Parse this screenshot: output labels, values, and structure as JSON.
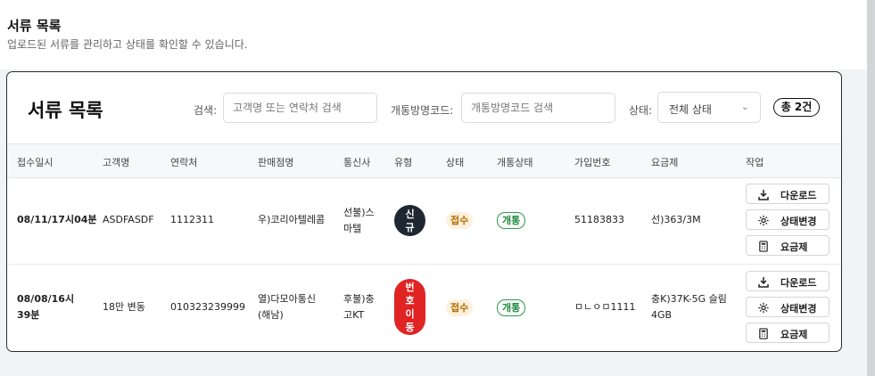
{
  "page": {
    "title": "서류 목록",
    "subtitle": "업로드된 서류를 관리하고 상태를 확인할 수 있습니다."
  },
  "card": {
    "title": "서류 목록",
    "search_label": "검색:",
    "search_placeholder": "고객명 또는 연락처 검색",
    "code_label": "개통방명코드:",
    "code_placeholder": "개통방명코드 검색",
    "status_label": "상태:",
    "status_value": "전체 상태",
    "total": "총 2건"
  },
  "table": {
    "headers": [
      "접수일시",
      "고객명",
      "연락처",
      "판매점명",
      "통신사",
      "유형",
      "상태",
      "개통상태",
      "가입번호",
      "요금제",
      "작업"
    ],
    "rows": [
      {
        "date": "08/11/17시04분",
        "customer": "ASDFASDF",
        "phone": "1112311",
        "store": "우)코리아텔레콤",
        "carrier": "선불)스마텔",
        "type_line1": "신",
        "type_line2": "규",
        "status": "접수",
        "open_status": "개통",
        "subscription_no": "51183833",
        "plan": "선)363/3M"
      },
      {
        "date": "08/08/16시39분",
        "customer": "18만 변동",
        "phone": "010323239999",
        "store": "열)다모아통신(해남)",
        "carrier": "후불)충고KT",
        "type_line1": "번",
        "type_line2": "호",
        "type_line3": "이",
        "type_line4": "동",
        "status": "접수",
        "open_status": "개통",
        "subscription_no": "ㅁㄴㅇㅁ1111",
        "plan": "충K)37K-5G 슬림 4GB"
      }
    ],
    "actions": {
      "download": "다운로드",
      "change_status": "상태변경",
      "plan": "요금제"
    }
  },
  "colors": {
    "new_type": "#1f2733",
    "transfer_type": "#e02424",
    "status_badge_bg": "#fdf1de",
    "open_badge": "#2b9a4a"
  }
}
